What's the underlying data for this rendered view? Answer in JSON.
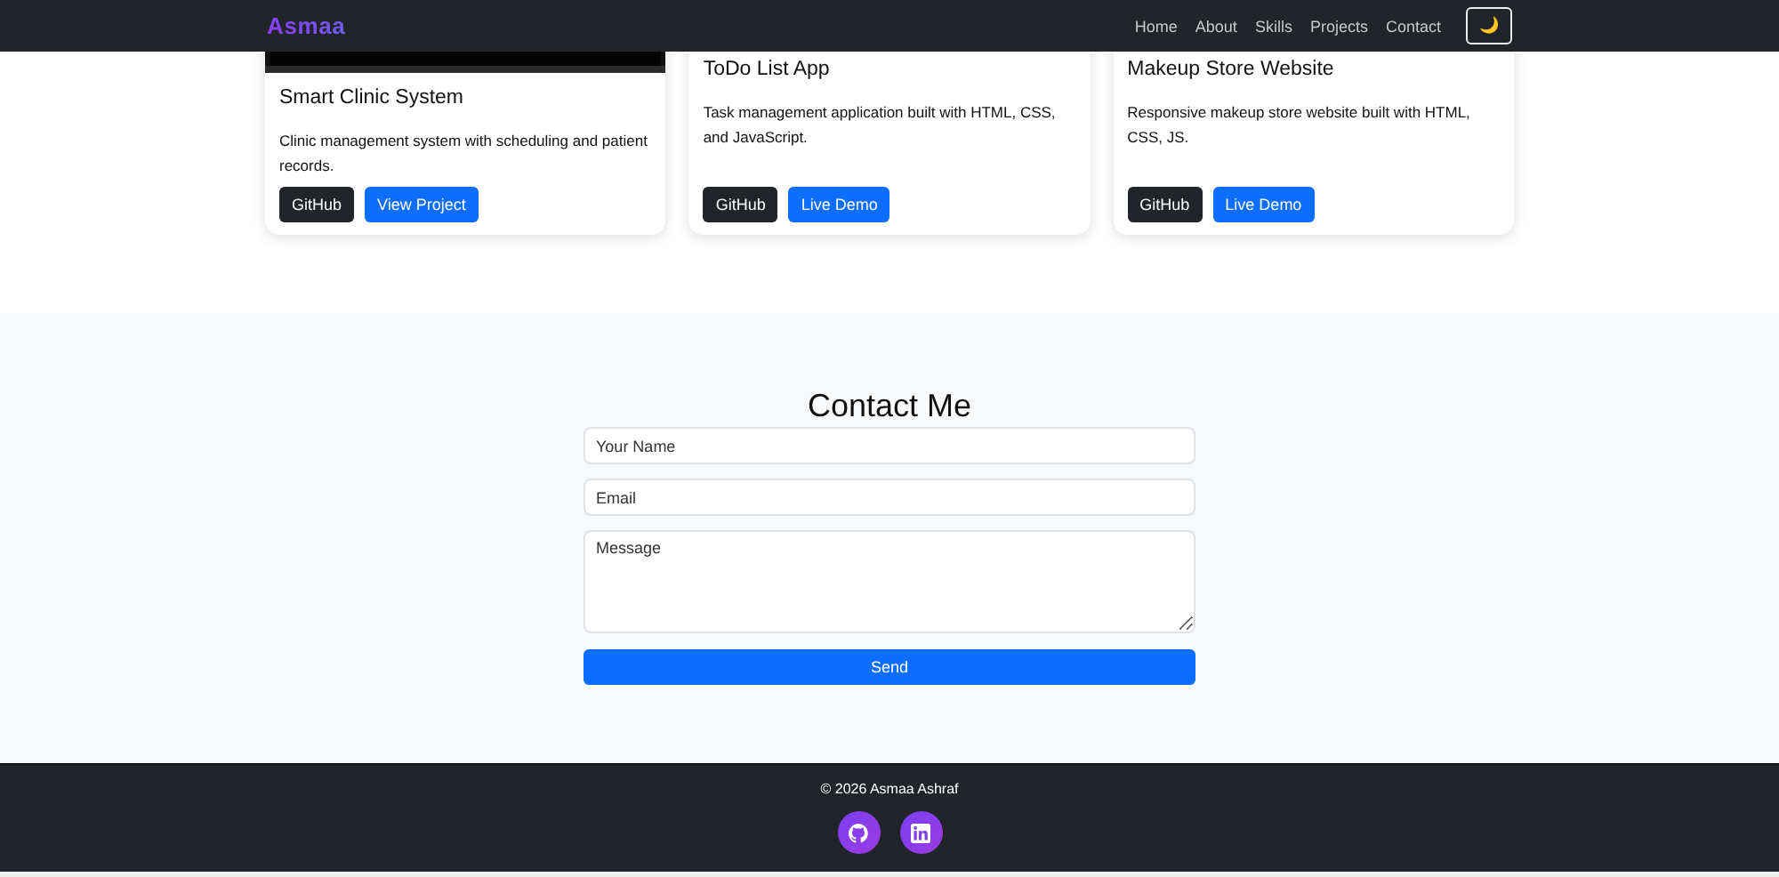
{
  "navbar": {
    "brand": "Asmaa",
    "links": [
      "Home",
      "About",
      "Skills",
      "Projects",
      "Contact"
    ],
    "theme_toggle": "🌙"
  },
  "projects": [
    {
      "image": {
        "kind": "picture"
      },
      "title": "Smart Clinic System",
      "description": "Clinic management system with scheduling and patient records.",
      "buttons": [
        {
          "label": "GitHub",
          "kind": "dark"
        },
        {
          "label": "View Project",
          "kind": "primary"
        }
      ]
    },
    {
      "title": "ToDo List App",
      "description": "Task management application built with HTML, CSS, and JavaScript.",
      "buttons": [
        {
          "label": "GitHub",
          "kind": "dark"
        },
        {
          "label": "Live Demo",
          "kind": "primary"
        }
      ]
    },
    {
      "title": "Makeup Store Website",
      "description": "Responsive makeup store website built with HTML, CSS, JS.",
      "buttons": [
        {
          "label": "GitHub",
          "kind": "dark"
        },
        {
          "label": "Live Demo",
          "kind": "primary"
        }
      ]
    }
  ],
  "contact": {
    "title": "Contact Me",
    "fields": [
      {
        "placeholder": "Your Name",
        "kind": "input"
      },
      {
        "placeholder": "Email",
        "kind": "input"
      },
      {
        "placeholder": "Message",
        "kind": "textarea"
      }
    ],
    "submit": "Send"
  },
  "footer": {
    "copyright": "© 2026 Asmaa Ashraf",
    "social": [
      {
        "kind": "github"
      },
      {
        "kind": "linkedin"
      }
    ]
  }
}
